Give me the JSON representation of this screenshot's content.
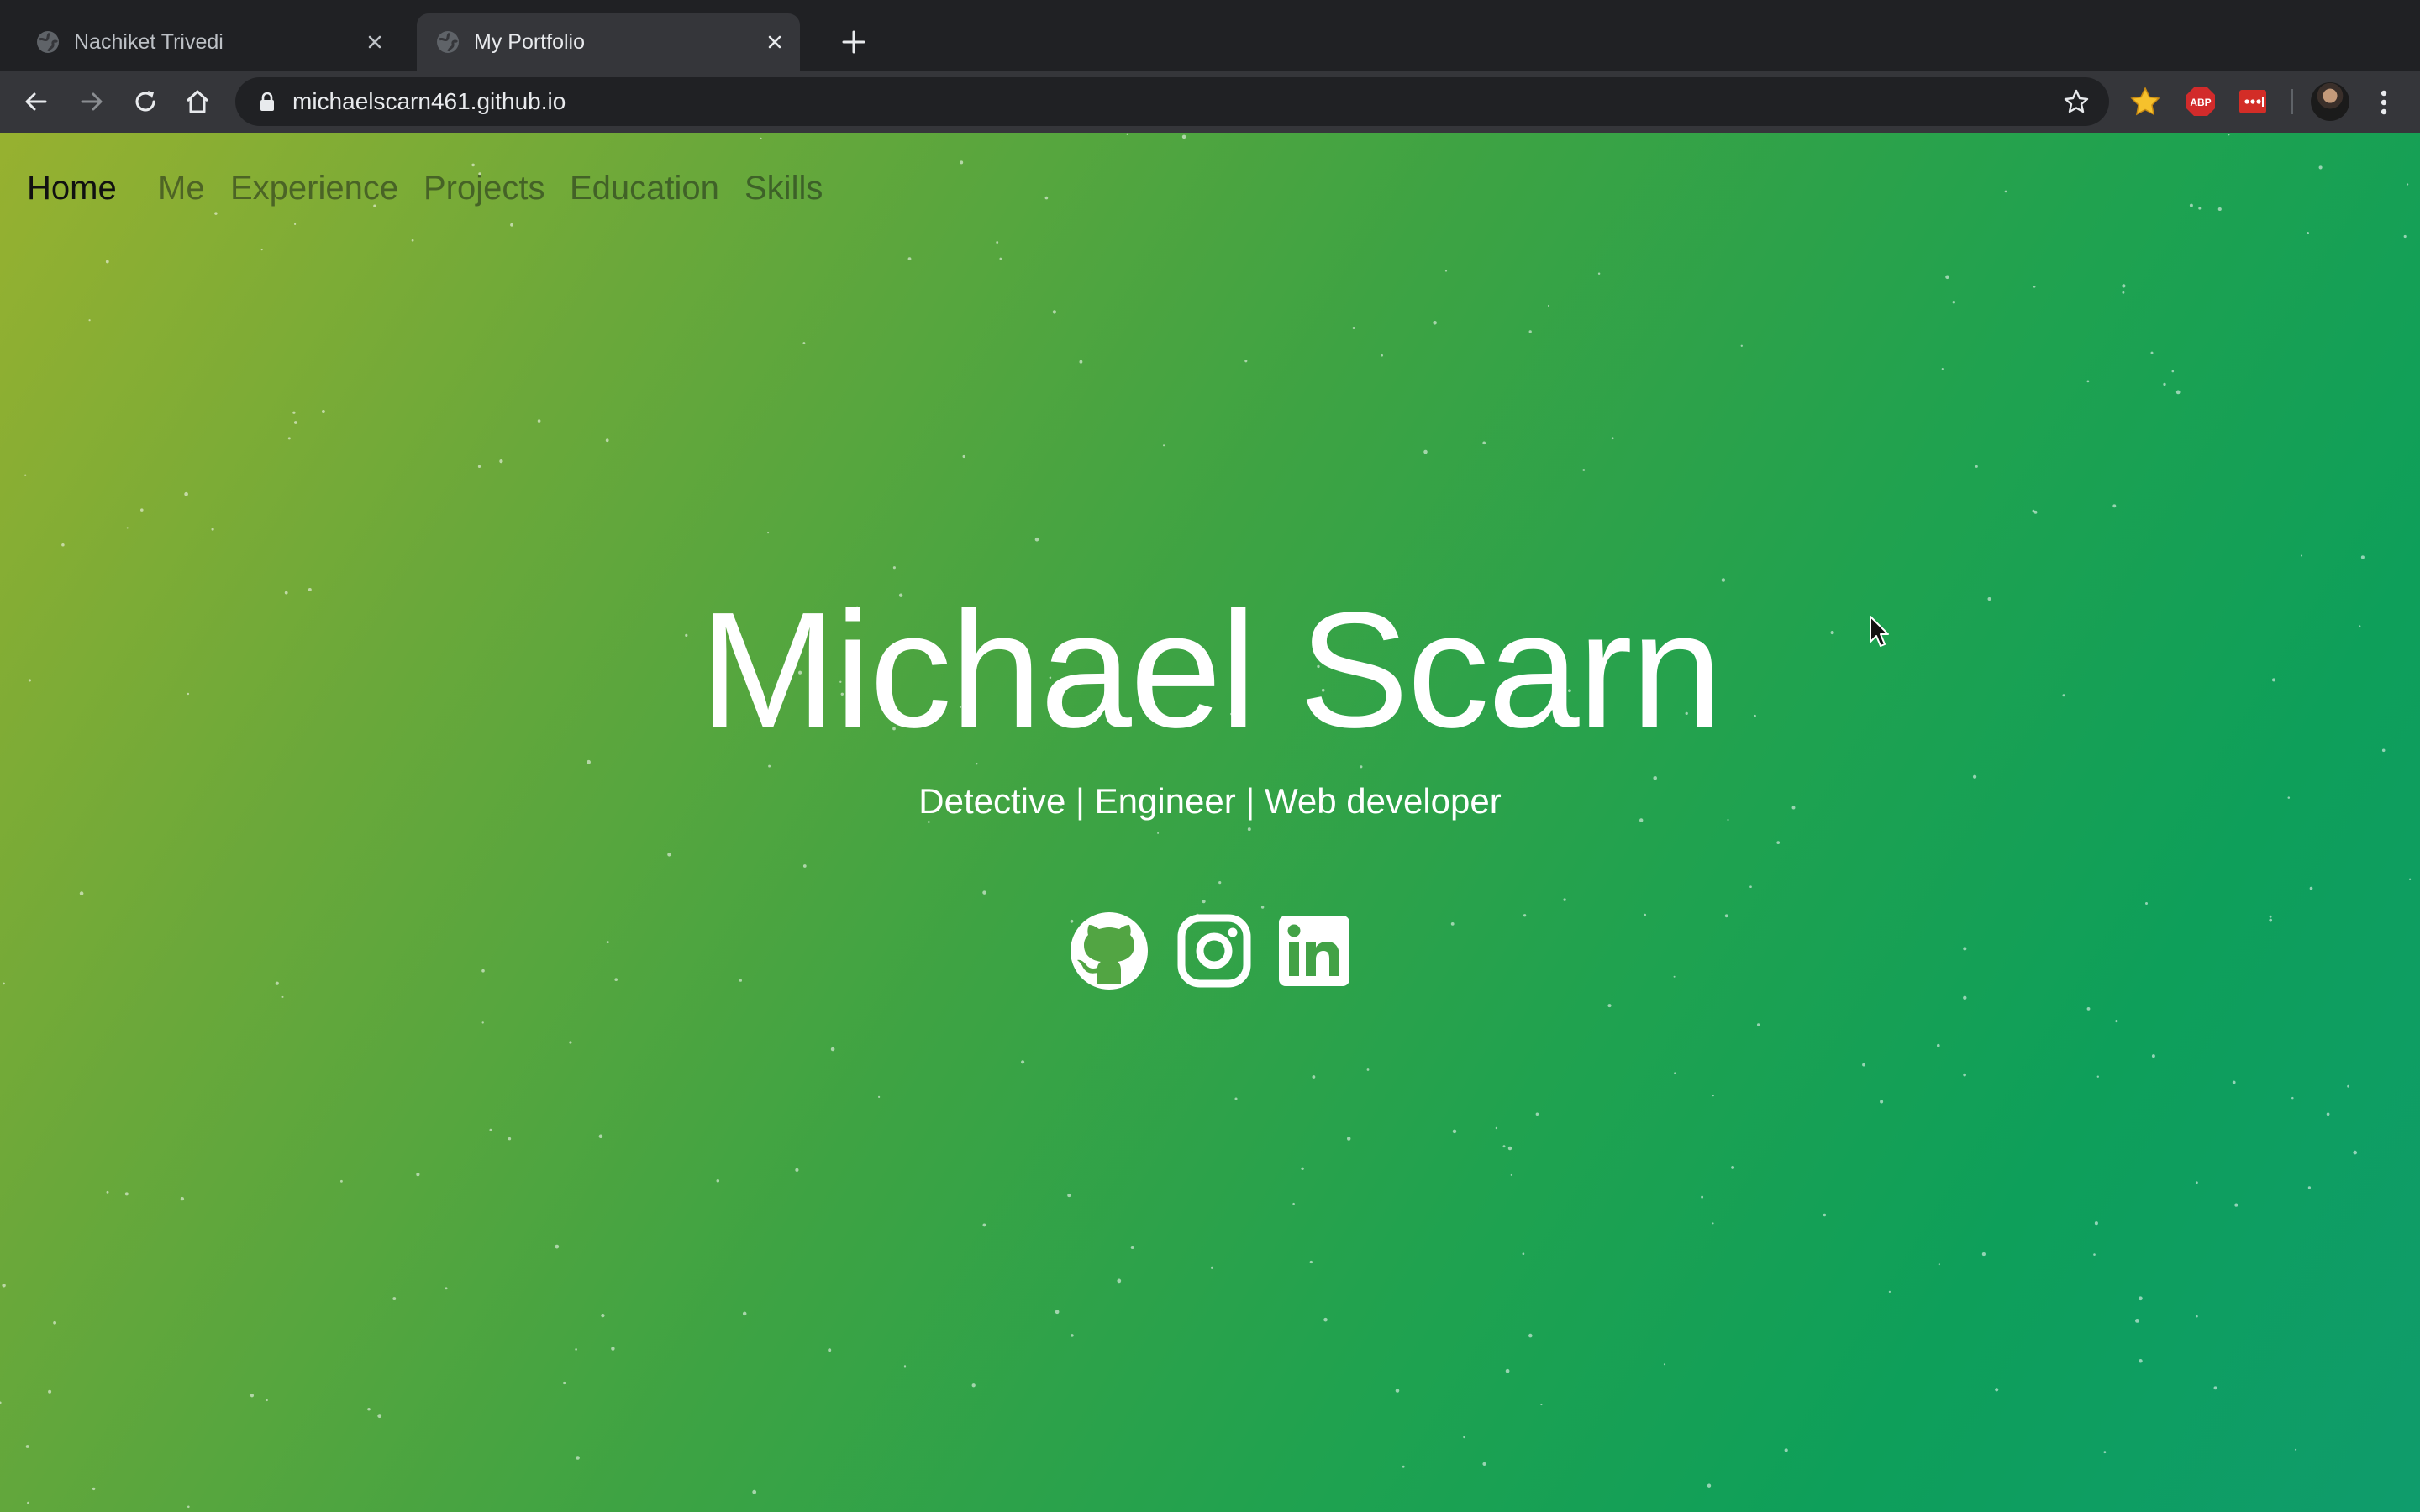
{
  "browser": {
    "tabs": [
      {
        "title": "Nachiket Trivedi",
        "active": false
      },
      {
        "title": "My Portfolio",
        "active": true
      }
    ],
    "url": "michaelscarn461.github.io",
    "extensions": [
      "bookmark-star-extension",
      "adblock-plus",
      "lastpass"
    ],
    "adblock_label": "ABP"
  },
  "page": {
    "nav": {
      "items": [
        "Home",
        "Me",
        "Experience",
        "Projects",
        "Education",
        "Skills"
      ],
      "active": "Home"
    },
    "hero": {
      "name": "Michael Scarn",
      "tagline": "Detective | Engineer | Web developer"
    },
    "social_icons": [
      "github-icon",
      "instagram-icon",
      "linkedin-icon"
    ]
  },
  "colors": {
    "gradient_start": "#97b130",
    "gradient_end": "#0f9c6c",
    "tab_active_bg": "#35363a",
    "tabstrip_bg": "#202124"
  }
}
